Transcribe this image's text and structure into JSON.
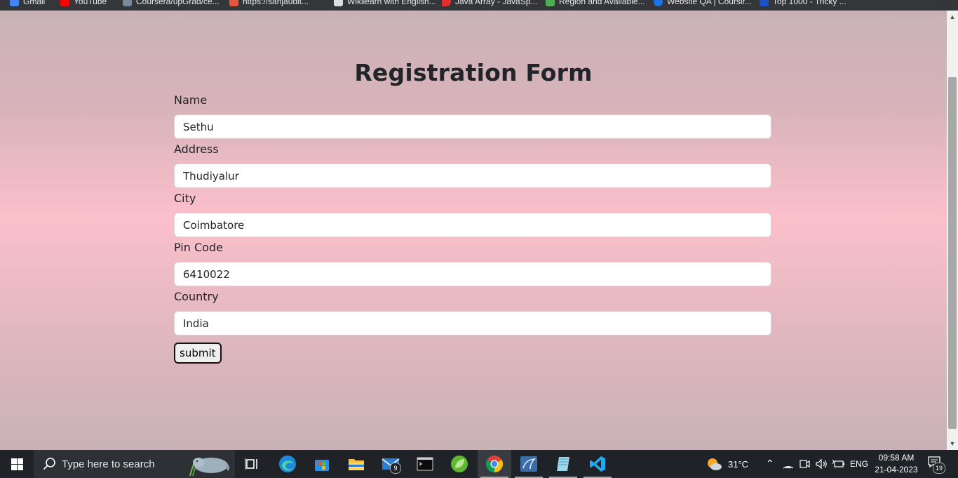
{
  "bookmarks": [
    {
      "label": "Gmail",
      "color": "#4285f4"
    },
    {
      "label": "YouTube",
      "color": "#ff0000"
    },
    {
      "label": "Coursera/upGrad/ce...",
      "color": "#7a8a99"
    },
    {
      "label": "https://sanjaudit...",
      "color": "#e8553d"
    },
    {
      "label": "Wikilearn with English...",
      "color": "#dddddd"
    },
    {
      "label": "Java Array - JavaSp...",
      "color": "#e03030"
    },
    {
      "label": "Region and Available...",
      "color": "#4caf50"
    },
    {
      "label": "Website QA | Coursir...",
      "color": "#1a73e8"
    },
    {
      "label": "Top 1000 - Tricky ...",
      "color": "#1a53c8"
    }
  ],
  "form": {
    "title": "Registration Form",
    "fields": [
      {
        "label": "Name",
        "value": "Sethu"
      },
      {
        "label": "Address",
        "value": "Thudiyalur"
      },
      {
        "label": "City",
        "value": "Coimbatore"
      },
      {
        "label": "Pin Code",
        "value": "6410022"
      },
      {
        "label": "Country",
        "value": "India"
      }
    ],
    "submit_label": "submit"
  },
  "taskbar": {
    "search_placeholder": "Type here to search",
    "mail_badge": "9",
    "weather": "31°C",
    "language": "ENG",
    "time": "09:58 AM",
    "date": "21-04-2023",
    "notification_count": "19"
  }
}
